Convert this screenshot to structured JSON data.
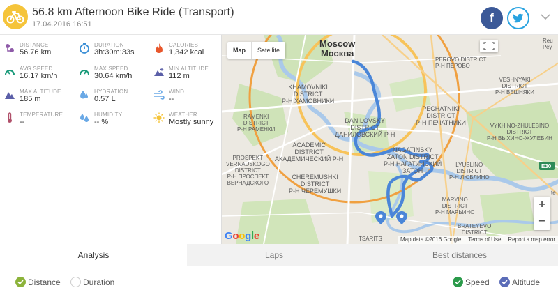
{
  "header": {
    "title": "56.8 km Afternoon Bike Ride (Transport)",
    "date": "17.04.2016 16:51"
  },
  "stats": [
    {
      "label": "DISTANCE",
      "value": "56.76 km",
      "icon": "distance-icon",
      "color": "#8e5aa8"
    },
    {
      "label": "DURATION",
      "value": "3h:30m:33s",
      "icon": "duration-icon",
      "color": "#3b8fd6"
    },
    {
      "label": "CALORIES",
      "value": "1,342 kcal",
      "icon": "calories-icon",
      "color": "#e8572c"
    },
    {
      "label": "AVG SPEED",
      "value": "16.17 km/h",
      "icon": "avg-speed-icon",
      "color": "#1a9a7a"
    },
    {
      "label": "MAX SPEED",
      "value": "30.64 km/h",
      "icon": "max-speed-icon",
      "color": "#1a9a7a"
    },
    {
      "label": "MIN ALTITUDE",
      "value": "112 m",
      "icon": "min-altitude-icon",
      "color": "#5b5fa8"
    },
    {
      "label": "MAX ALTITUDE",
      "value": "185 m",
      "icon": "max-altitude-icon",
      "color": "#5b5fa8"
    },
    {
      "label": "HYDRATION",
      "value": "0.57 L",
      "icon": "hydration-icon",
      "color": "#6aa9e6"
    },
    {
      "label": "WIND",
      "value": "--",
      "icon": "wind-icon",
      "color": "#6aa9e6"
    },
    {
      "label": "TEMPERATURE",
      "value": "--",
      "icon": "temperature-icon",
      "color": "#b0506a"
    },
    {
      "label": "HUMIDITY",
      "value": "-- %",
      "icon": "humidity-icon",
      "color": "#6aa9e6"
    },
    {
      "label": "WEATHER",
      "value": "Mostly sunny",
      "icon": "sun-icon",
      "color": "#f5c43a"
    }
  ],
  "map": {
    "type_map": "Map",
    "type_satellite": "Satellite",
    "zoom_in": "+",
    "zoom_out": "−",
    "logo": "Google",
    "attribution_data": "Map data ©2016 Google",
    "attribution_terms": "Terms of Use",
    "attribution_report": "Report a map error",
    "route_color": "#4a86d8",
    "labels": {
      "city": [
        "Moscow",
        "Москва"
      ],
      "perovo": [
        "PEROVO DISTRICT",
        "Р-Н ПЕРОВО"
      ],
      "veshnyaki": [
        "VESHNYAKI",
        "DISTRICT",
        "Р-Н ВЕШНЯКИ"
      ],
      "khamovniki": [
        "KHAMOVNIKI",
        "DISTRICT",
        "Р-Н ХАМОВНИКИ"
      ],
      "ramenki": [
        "RAMENKI",
        "DISTRICT",
        "Р-Н РАМЕНКИ"
      ],
      "danilovsky": [
        "DANILOVSKY",
        "DISTRICT",
        "ДАНИЛОВСКИЙ Р-Н"
      ],
      "pechatniki": [
        "PECHATNIKI",
        "DISTRICT",
        "Р-Н ПЕЧАТНИКИ"
      ],
      "vykhino": [
        "VYKHINO-ZHULEBINO",
        "DISTRICT",
        "Р-Н ВЫХИНО-ЖУЛЕБИН"
      ],
      "academic": [
        "ACADEMIC",
        "DISTRICT",
        "АКАДЕМИЧЕСКИЙ Р-Н"
      ],
      "nagatinsky": [
        "NAGATINSKY",
        "ZATON DISTRICT",
        "Р-Н НАГАТИНСКИЙ",
        "ЗАТОН"
      ],
      "lyublino": [
        "LYUBLINO",
        "DISTRICT",
        "Р-Н ЛЮБЛИНО"
      ],
      "prospekt": [
        "PROSPEKT",
        "VERNADSKOGO",
        "DISTRICT",
        "Р-Н ПРОСПЕКТ",
        "ВЕРНАДСКОГО"
      ],
      "cheremushki": [
        "CHEREMUSHKI",
        "DISTRICT",
        "Р-Н ЧЕРЕМУШКИ"
      ],
      "maryino": [
        "MARYINO",
        "DISTRICT",
        "Р-Н МАРЬИНО"
      ],
      "brateyevo": [
        "BRATEYEVO",
        "DISTRICT"
      ],
      "tsaritsino": [
        "TSARITS"
      ],
      "reu": [
        "Reu",
        "Реу"
      ],
      "e30": "E30",
      "te": "te"
    }
  },
  "tabs": [
    "Analysis",
    "Laps",
    "Best distances"
  ],
  "toggles": {
    "distance": "Distance",
    "duration": "Duration",
    "speed": "Speed",
    "altitude": "Altitude"
  },
  "colors": {
    "accent_green": "#8cb33a",
    "speed_green": "#2a9a4a",
    "altitude_blue": "#5b6cb8"
  }
}
